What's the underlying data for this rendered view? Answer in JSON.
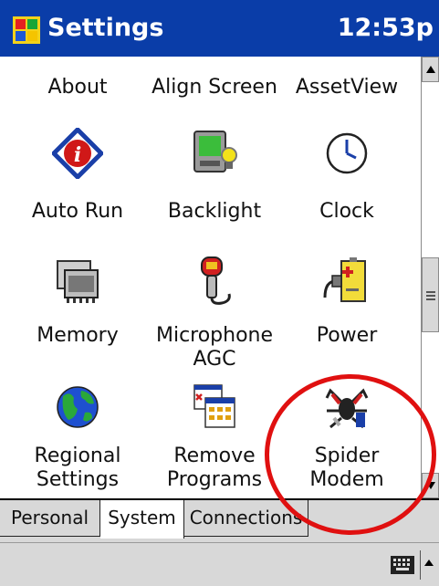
{
  "titlebar": {
    "title": "Settings",
    "time": "12:53p"
  },
  "items": [
    {
      "label": "About",
      "icon": "about-icon"
    },
    {
      "label": "Align Screen",
      "icon": "align-screen-icon"
    },
    {
      "label": "AssetView",
      "icon": "assetview-icon"
    },
    {
      "label": "Auto Run",
      "icon": "autorun-icon"
    },
    {
      "label": "Backlight",
      "icon": "backlight-icon"
    },
    {
      "label": "Clock",
      "icon": "clock-icon"
    },
    {
      "label": "Memory",
      "icon": "memory-icon"
    },
    {
      "label": "Microphone",
      "label2": "AGC",
      "icon": "microphone-icon"
    },
    {
      "label": "Power",
      "icon": "power-icon"
    },
    {
      "label": "Regional",
      "label2": "Settings",
      "icon": "globe-icon"
    },
    {
      "label": "Remove",
      "label2": "Programs",
      "icon": "remove-programs-icon"
    },
    {
      "label": "Spider",
      "label2": "Modem",
      "icon": "spider-modem-icon"
    }
  ],
  "tabs": [
    "Personal",
    "System",
    "Connections"
  ],
  "active_tab": "System",
  "colors": {
    "titlebar": "#0a3da8",
    "annotation": "#e01010"
  }
}
